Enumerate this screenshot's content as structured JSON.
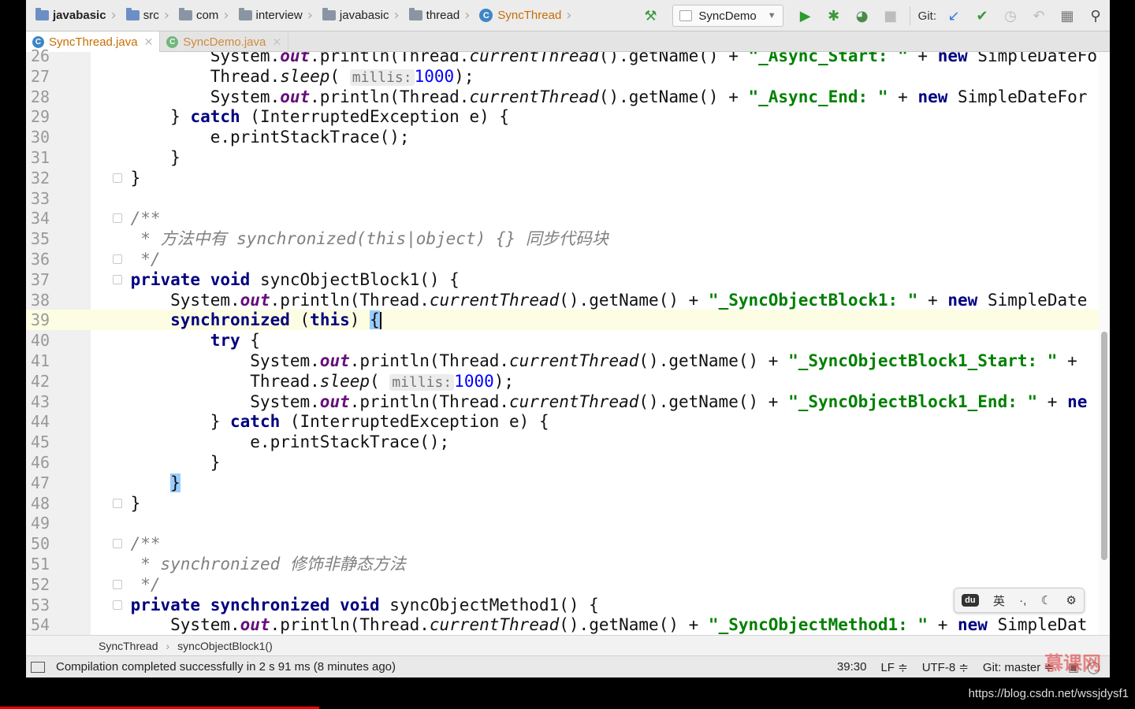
{
  "navbar": {
    "crumbs": [
      {
        "label": "javabasic",
        "icon": "module-folder-icon"
      },
      {
        "label": "src",
        "icon": "folder-icon"
      },
      {
        "label": "com",
        "icon": "folder-icon"
      },
      {
        "label": "interview",
        "icon": "folder-icon"
      },
      {
        "label": "javabasic",
        "icon": "folder-icon"
      },
      {
        "label": "thread",
        "icon": "folder-icon"
      },
      {
        "label": "SyncThread",
        "icon": "class-icon"
      }
    ],
    "class_badge": "C"
  },
  "toolbar": {
    "run_config": "SyncDemo",
    "git_label": "Git:"
  },
  "tabs": [
    {
      "label": "SyncThread.java",
      "active": true
    },
    {
      "label": "SyncDemo.java",
      "active": false
    }
  ],
  "editor": {
    "line_numbers": [
      "26",
      "27",
      "28",
      "29",
      "30",
      "31",
      "32",
      "33",
      "34",
      "35",
      "36",
      "37",
      "38",
      "39",
      "40",
      "41",
      "42",
      "43",
      "44",
      "45",
      "46",
      "47",
      "48",
      "49",
      "50",
      "51",
      "52",
      "53",
      "54"
    ],
    "current_line": "39",
    "param_hint": "millis:",
    "code": {
      "l26_a": "            System.",
      "l26_b": "out",
      "l26_c": ".println(Thread.",
      "l26_d": "currentThread",
      "l26_e": "().getName() + ",
      "l26_f": "\"_Async_Start: \"",
      "l26_g": " + ",
      "l26_h": "new",
      "l26_i": " SimpleDateFor",
      "l27_a": "            Thread.",
      "l27_b": "sleep",
      "l27_c": "( ",
      "l27_d": "1000",
      "l27_e": ");",
      "l28_a": "            System.",
      "l28_b": "out",
      "l28_c": ".println(Thread.",
      "l28_d": "currentThread",
      "l28_e": "().getName() + ",
      "l28_f": "\"_Async_End: \"",
      "l28_g": " + ",
      "l28_h": "new",
      "l28_i": " SimpleDateFor",
      "l29_a": "        } ",
      "l29_b": "catch",
      "l29_c": " (InterruptedException e) {",
      "l30": "            e.printStackTrace();",
      "l31": "        }",
      "l32": "    }",
      "l34": "    /**",
      "l35_a": "     * 方法中有 ",
      "l35_b": "synchronized(this|object) {}",
      "l35_c": " 同步代码块",
      "l36": "     */",
      "l37_a": "    ",
      "l37_b": "private void",
      "l37_c": " syncObjectBlock1() {",
      "l38_a": "        System.",
      "l38_b": "out",
      "l38_c": ".println(Thread.",
      "l38_d": "currentThread",
      "l38_e": "().getName() + ",
      "l38_f": "\"_SyncObjectBlock1: \"",
      "l38_g": " + ",
      "l38_h": "new",
      "l38_i": " SimpleDate",
      "l39_a": "        ",
      "l39_b": "synchronized",
      "l39_c": " (",
      "l39_d": "this",
      "l39_e": ") ",
      "l39_f": "{",
      "l40_a": "            ",
      "l40_b": "try",
      "l40_c": " {",
      "l41_a": "                System.",
      "l41_b": "out",
      "l41_c": ".println(Thread.",
      "l41_d": "currentThread",
      "l41_e": "().getName() + ",
      "l41_f": "\"_SyncObjectBlock1_Start: \"",
      "l41_g": " +",
      "l42_a": "                Thread.",
      "l42_b": "sleep",
      "l42_c": "( ",
      "l42_d": "1000",
      "l42_e": ");",
      "l43_a": "                System.",
      "l43_b": "out",
      "l43_c": ".println(Thread.",
      "l43_d": "currentThread",
      "l43_e": "().getName() + ",
      "l43_f": "\"_SyncObjectBlock1_End: \"",
      "l43_g": " + ",
      "l43_h": "ne",
      "l44_a": "            } ",
      "l44_b": "catch",
      "l44_c": " (InterruptedException e) {",
      "l45": "                e.printStackTrace();",
      "l46": "            }",
      "l47_a": "        ",
      "l47_b": "}",
      "l48": "    }",
      "l50": "    /**",
      "l51_a": "     * ",
      "l51_b": "synchronized",
      "l51_c": " 修饰非静态方法",
      "l52": "     */",
      "l53_a": "    ",
      "l53_b": "private synchronized void",
      "l53_c": " syncObjectMethod1() {",
      "l54_a": "        System.",
      "l54_b": "out",
      "l54_c": ".println(Thread.",
      "l54_d": "currentThread",
      "l54_e": "().getName() + ",
      "l54_f": "\"_SyncObjectMethod1: \"",
      "l54_g": " + ",
      "l54_h": "new",
      "l54_i": " SimpleDat"
    }
  },
  "breadcrumbs": {
    "items": [
      "SyncThread",
      "syncObjectBlock1()"
    ]
  },
  "status": {
    "message": "Compilation completed successfully in 2 s 91 ms (8 minutes ago)",
    "position": "39:30",
    "line_sep": "LF ≑",
    "encoding": "UTF-8 ≑",
    "git": "Git: master ≑"
  },
  "ime": {
    "logo": "du",
    "lang": "英",
    "punct": "·,"
  },
  "watermark": "慕课网",
  "url": "https://blog.csdn.net/wssjdysf1",
  "colors": {
    "keyword": "#000080",
    "string": "#008000",
    "number": "#0000ff",
    "field": "#660e7a",
    "comment": "#808080",
    "current_line": "#fdfde4",
    "active_tab": "#c76e00"
  }
}
